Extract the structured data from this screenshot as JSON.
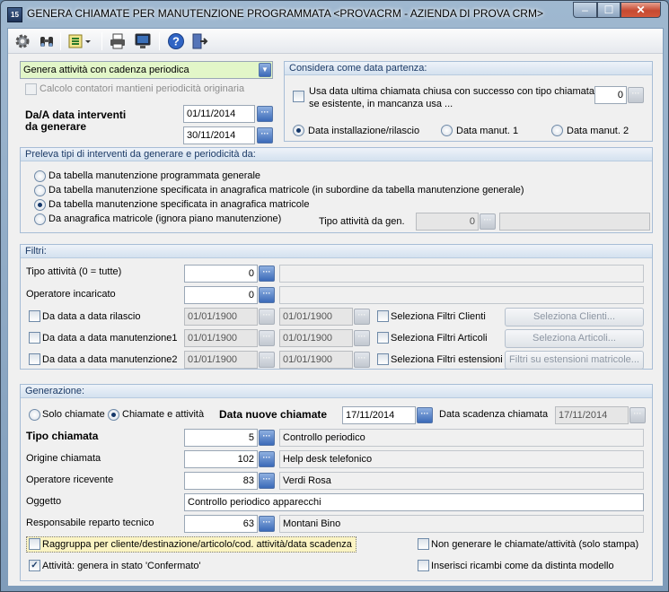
{
  "window": {
    "title": "GENERA CHIAMATE PER MANUTENZIONE PROGRAMMATA <PROVACRM - AZIENDA DI PROVA CRM>",
    "app_icon": "15",
    "min": "–",
    "max": "☐",
    "close": "✕"
  },
  "toolbar": {
    "icons": [
      "gear-icon",
      "binoculars-icon",
      "list-dropdown-icon",
      "printer-icon",
      "monitor-icon",
      "help-icon",
      "exit-icon"
    ]
  },
  "top": {
    "mode_select": "Genera attività con cadenza periodica",
    "calc_counters": "Calcolo contatori mantieni periodicità originaria",
    "date_range_label_1": "Da/A data interventi",
    "date_range_label_2": "da generare",
    "date_from": "01/11/2014",
    "date_to": "30/11/2014"
  },
  "start_date": {
    "header": "Considera come data partenza:",
    "use_last_line1": "Usa data ultima chiamata chiusa con successo con tipo chiamata",
    "use_last_line2": "se esistente, in mancanza usa ...",
    "call_type_value": "0",
    "opt_install": "Data installazione/rilascio",
    "opt_manut1": "Data manut. 1",
    "opt_manut2": "Data manut. 2"
  },
  "types": {
    "header": "Preleva tipi di interventi da generare e periodicità da:",
    "opt1": "Da tabella manutenzione programmata generale",
    "opt2": "Da tabella manutenzione specificata in anagrafica matricole (in subordine da tabella manutenzione generale)",
    "opt3": "Da tabella manutenzione specificata in anagrafica matricole",
    "opt4": "Da anagrafica matricole (ignora piano manutenzione)",
    "activity_type_label": "Tipo attività da gen.",
    "activity_type_value": "0",
    "activity_type_desc": ""
  },
  "filters": {
    "header": "Filtri:",
    "activity_type_label": "Tipo attività (0 = tutte)",
    "activity_type_value": "0",
    "activity_type_desc": "",
    "operator_label": "Operatore incaricato",
    "operator_value": "0",
    "operator_desc": "",
    "release_label": "Da data a data rilascio",
    "manut1_label": "Da data a data manutenzione1",
    "manut2_label": "Da data a data manutenzione2",
    "date_default": "01/01/1900",
    "sel_clients_label": "Seleziona Filtri Clienti",
    "sel_articles_label": "Seleziona Filtri Articoli",
    "sel_ext_label": "Seleziona Filtri estensioni",
    "btn_clients": "Seleziona Clienti...",
    "btn_articles": "Seleziona Articoli...",
    "btn_ext": "Filtri su estensioni matricole..."
  },
  "generation": {
    "header": "Generazione:",
    "opt_calls_only": "Solo chiamate",
    "opt_calls_activities": "Chiamate e attività",
    "new_calls_date_label": "Data nuove chiamate",
    "new_calls_date": "17/11/2014",
    "due_date_label": "Data scadenza chiamata",
    "due_date": "17/11/2014",
    "call_type_label": "Tipo chiamata",
    "call_type_value": "5",
    "call_type_desc": "Controllo periodico",
    "origin_label": "Origine chiamata",
    "origin_value": "102",
    "origin_desc": "Help desk telefonico",
    "receiver_label": "Operatore ricevente",
    "receiver_value": "83",
    "receiver_desc": "Verdi Rosa",
    "subject_label": "Oggetto",
    "subject_value": "Controllo periodico apparecchi",
    "tech_label": "Responsabile reparto tecnico",
    "tech_value": "63",
    "tech_desc": "Montani Bino",
    "group_label": "Raggruppa per cliente/destinazione/articolo/cod. attività/data scadenza",
    "no_generate_label": "Non generare le chiamate/attività (solo stampa)",
    "activities_confirmed_label": "Attività: genera in stato 'Confermato'",
    "insert_parts_label": "Inserisci ricambi come da distinta modello",
    "ellipsis": "···",
    "check": "✓"
  }
}
